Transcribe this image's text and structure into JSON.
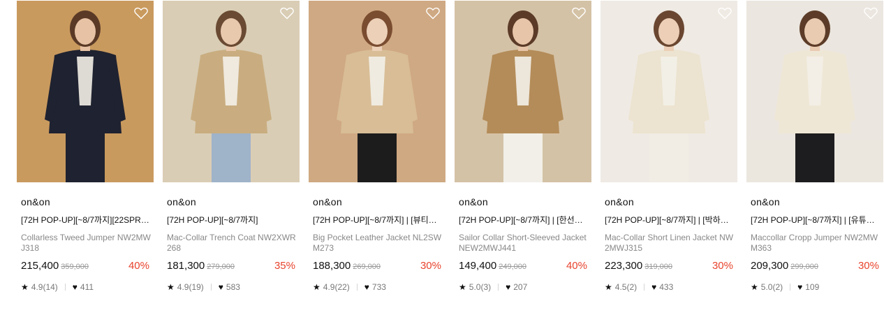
{
  "products": [
    {
      "brand": "on&on",
      "tag": "[72H POP-UP][~8/7까지][22SPR…",
      "name": "Collarless Tweed Jumper NW2MWJ318",
      "price": "215,400",
      "original_price": "359,000",
      "discount": "40%",
      "rating": "4.9(14)",
      "likes": "411",
      "image": {
        "background": "#c99a5e",
        "garment": "#1f2230",
        "skin": "#e7c2a4",
        "hair": "#5a3a26",
        "bottom": "#1f2230",
        "icon": "tweed-jumper-photo"
      }
    },
    {
      "brand": "on&on",
      "tag": "[72H POP-UP][~8/7까지]",
      "name": "Mac-Collar Trench Coat NW2XWR268",
      "price": "181,300",
      "original_price": "279,000",
      "discount": "35%",
      "rating": "4.9(19)",
      "likes": "583",
      "image": {
        "background": "#d9cdb5",
        "garment": "#c9ad80",
        "skin": "#e9c9ae",
        "hair": "#6a4a32",
        "bottom": "#9fb3c9",
        "icon": "trench-coat-photo"
      }
    },
    {
      "brand": "on&on",
      "tag": "[72H POP-UP][~8/7까지] | [뷰티…",
      "name": "Big Pocket Leather Jacket NL2SWM273",
      "price": "188,300",
      "original_price": "269,000",
      "discount": "30%",
      "rating": "4.9(22)",
      "likes": "733",
      "image": {
        "background": "#cfa983",
        "garment": "#d8bd96",
        "skin": "#ecd0b8",
        "hair": "#7a4c30",
        "bottom": "#1c1c1c",
        "icon": "leather-jacket-photo"
      }
    },
    {
      "brand": "on&on",
      "tag": "[72H POP-UP][~8/7까지] | [한선…",
      "name": "Sailor Collar Short-Sleeved Jacket NEW2MWJ441",
      "price": "149,400",
      "original_price": "249,000",
      "discount": "40%",
      "rating": "5.0(3)",
      "likes": "207",
      "image": {
        "background": "#d4c2a6",
        "garment": "#b48c59",
        "skin": "#e7c5a8",
        "hair": "#5b3b28",
        "bottom": "#f2efe8",
        "icon": "sailor-jacket-photo"
      }
    },
    {
      "brand": "on&on",
      "tag": "[72H POP-UP][~8/7까지] | [박하…",
      "name": "Mac-Collar Short Linen Jacket NW2MWJ315",
      "price": "223,300",
      "original_price": "319,000",
      "discount": "30%",
      "rating": "4.5(2)",
      "likes": "433",
      "image": {
        "background": "#efeae3",
        "garment": "#ece3d0",
        "skin": "#eccfb6",
        "hair": "#6a4630",
        "bottom": "#f1ede4",
        "icon": "linen-jacket-photo"
      }
    },
    {
      "brand": "on&on",
      "tag": "[72H POP-UP][~8/7까지] | [유튜…",
      "name": "Maccollar Cropp Jumper NW2MWM363",
      "price": "209,300",
      "original_price": "299,000",
      "discount": "30%",
      "rating": "5.0(2)",
      "likes": "109",
      "image": {
        "background": "#ebe6df",
        "garment": "#efe7d6",
        "skin": "#e9cbb1",
        "hair": "#5c3c28",
        "bottom": "#1d1d1f",
        "icon": "cropp-jumper-photo"
      }
    }
  ],
  "colors": {
    "discount": "#e8432d",
    "muted": "#888888",
    "text": "#111111"
  },
  "icons": {
    "wish": "heart-outline-icon",
    "rating": "star-icon",
    "likes": "heart-icon"
  }
}
